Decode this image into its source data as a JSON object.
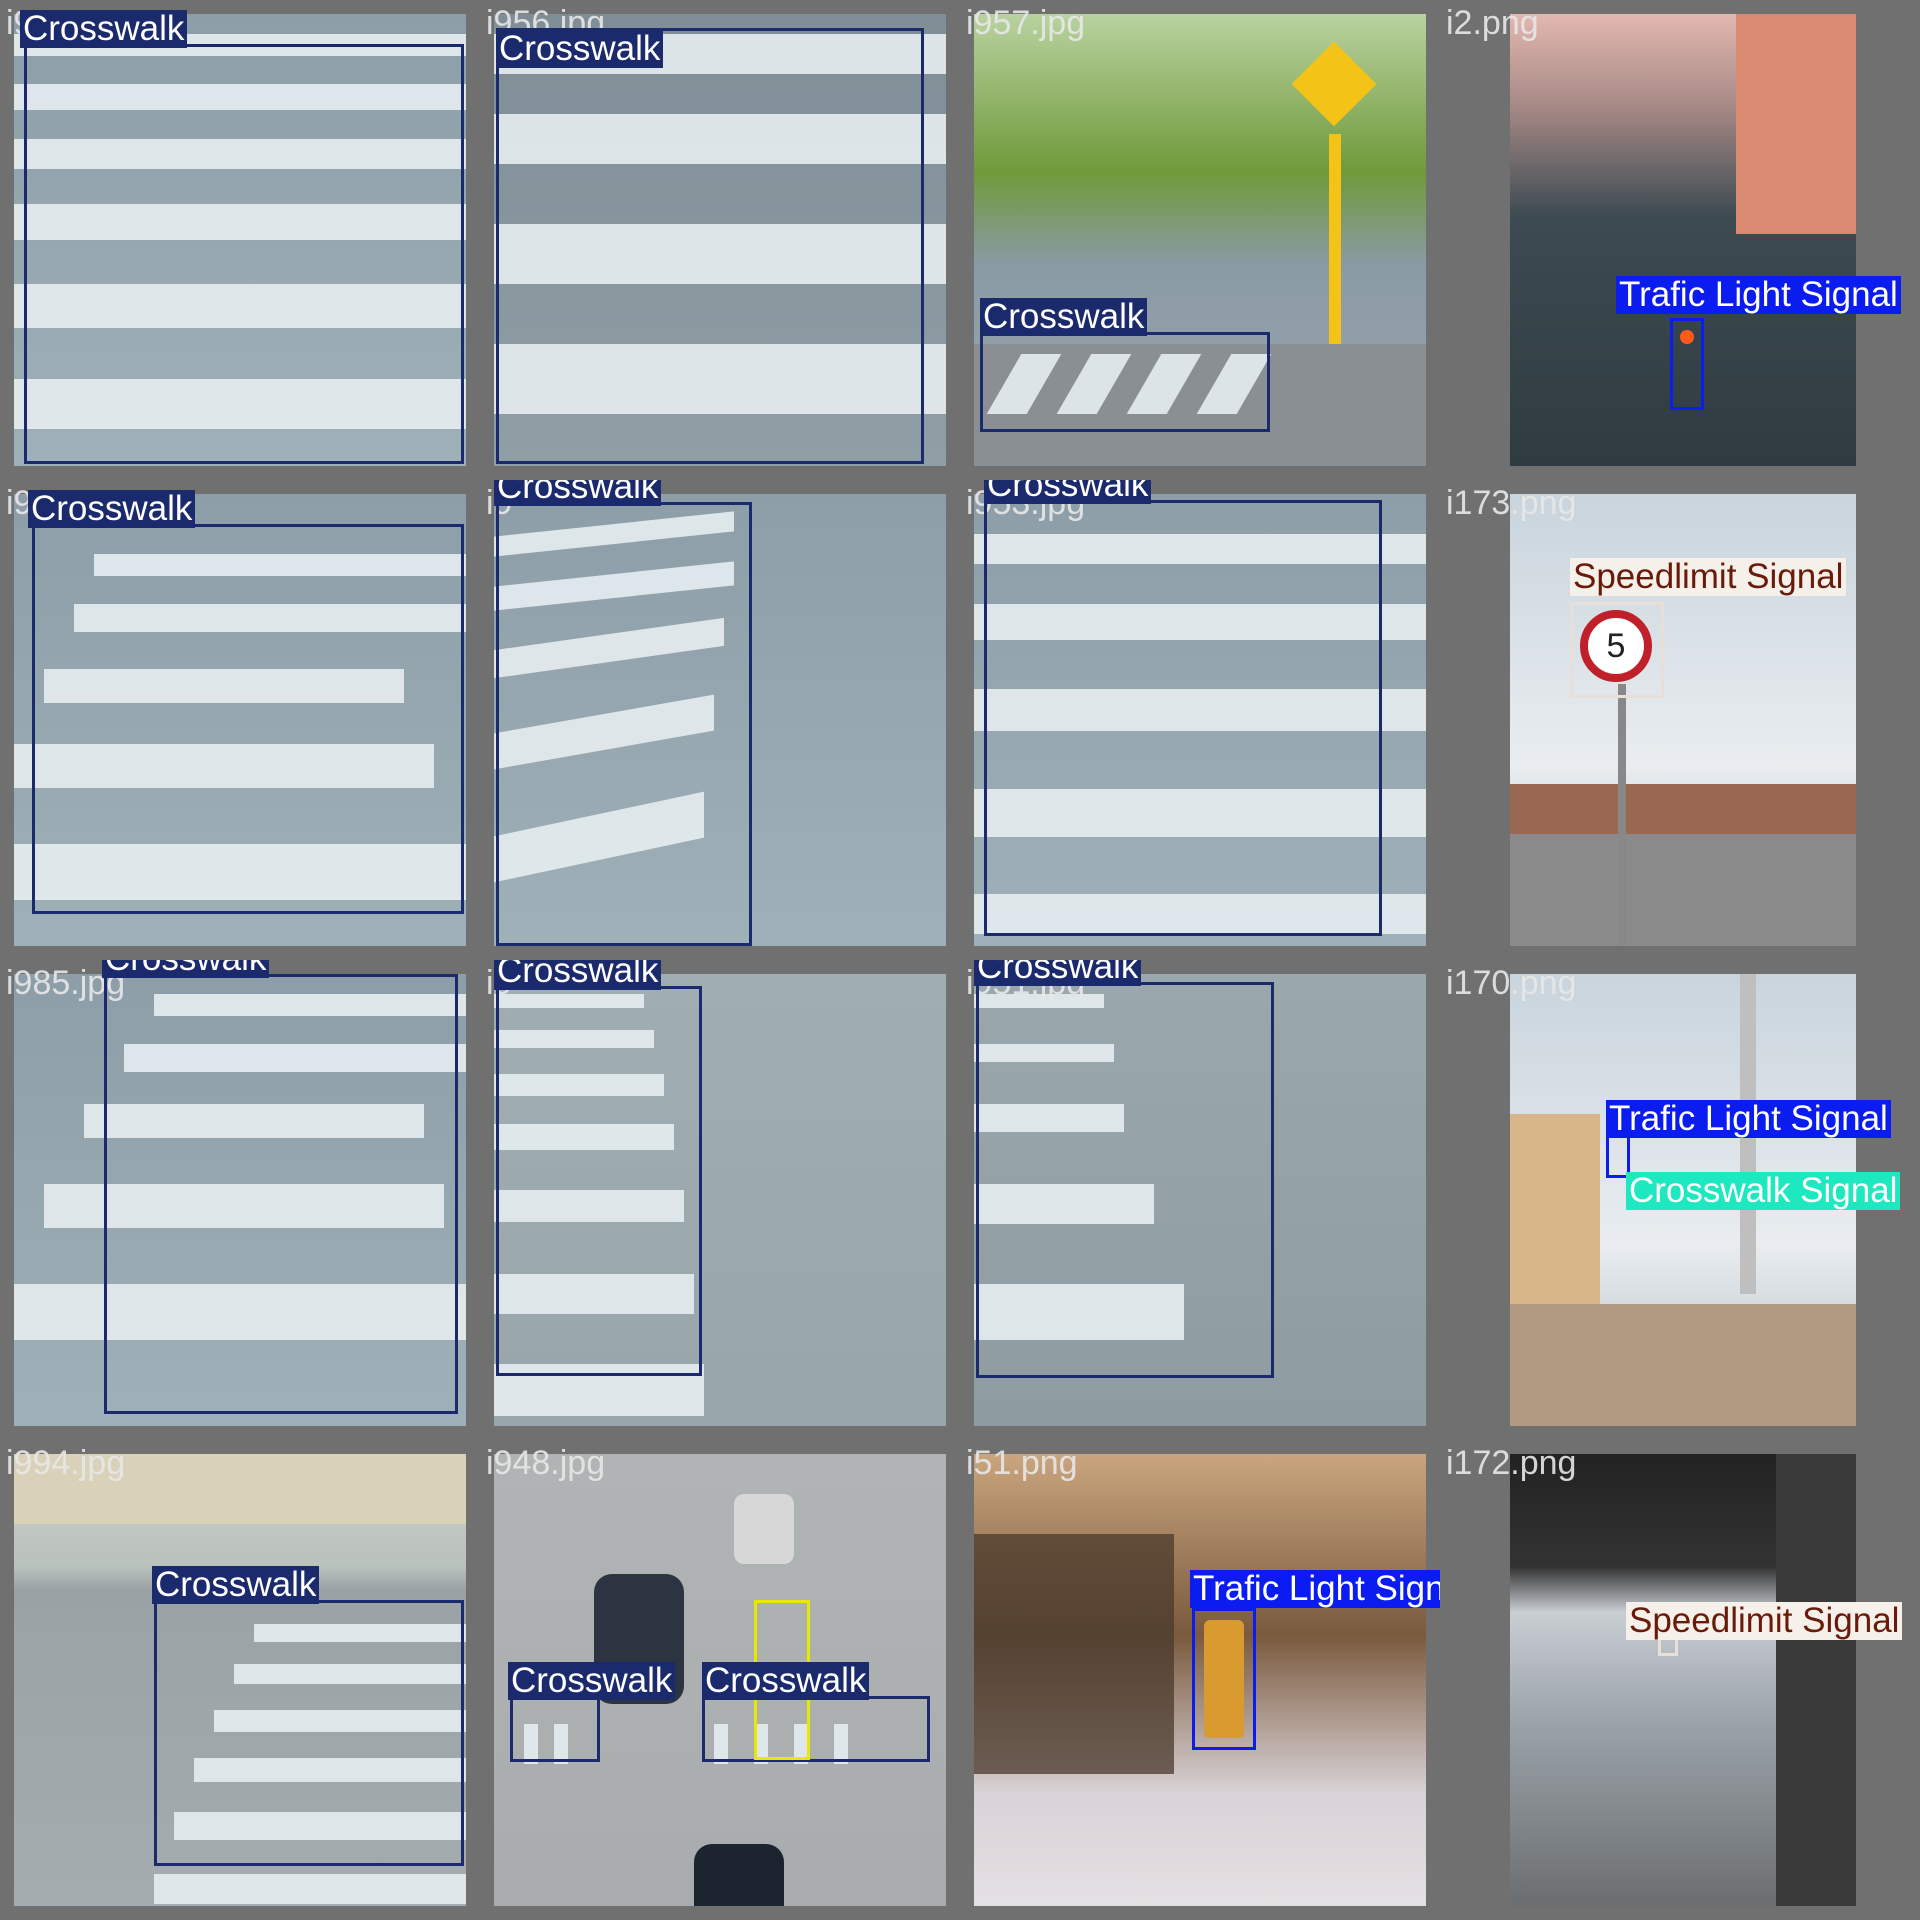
{
  "grid": [
    {
      "file": "i9",
      "labels": [
        "Crosswalk"
      ]
    },
    {
      "file": "i956.jpg",
      "labels": [
        "Crosswalk"
      ]
    },
    {
      "file": "i957.jpg",
      "labels": [
        "Crosswalk"
      ]
    },
    {
      "file": "i2.png",
      "labels": [
        "Trafic Light Signal"
      ]
    },
    {
      "file": "i9",
      "labels": [
        "Crosswalk"
      ]
    },
    {
      "file": "i9",
      "labels": [
        "Crosswalk"
      ]
    },
    {
      "file": "i953.jpg",
      "labels": [
        "Crosswalk"
      ]
    },
    {
      "file": "i173.png",
      "labels": [
        "Speedlimit Signal"
      ]
    },
    {
      "file": "i985.jpg",
      "labels": [
        "Crosswalk"
      ]
    },
    {
      "file": "i9",
      "labels": [
        "Crosswalk"
      ]
    },
    {
      "file": "i951.jpg",
      "labels": [
        "Crosswalk"
      ]
    },
    {
      "file": "i170.png",
      "labels": [
        "Trafic Light Signal",
        "Crosswalk Signal"
      ]
    },
    {
      "file": "i994.jpg",
      "labels": [
        "Crosswalk"
      ]
    },
    {
      "file": "i948.jpg",
      "labels": [
        "Crosswalk",
        "Crosswalk"
      ]
    },
    {
      "file": "i51.png",
      "labels": [
        "Trafic Light Signal"
      ]
    },
    {
      "file": "i172.png",
      "labels": [
        "Speedlimit Signal"
      ]
    }
  ],
  "colors": {
    "crosswalk": "#1a2a6c",
    "trafic_light_signal": "#0a1cf0",
    "speedlimit_signal": "#f6f0ea",
    "crosswalk_signal": "#1ee8c0",
    "pedestrian_box": "#e8e800"
  },
  "speed_sign_value": "5"
}
